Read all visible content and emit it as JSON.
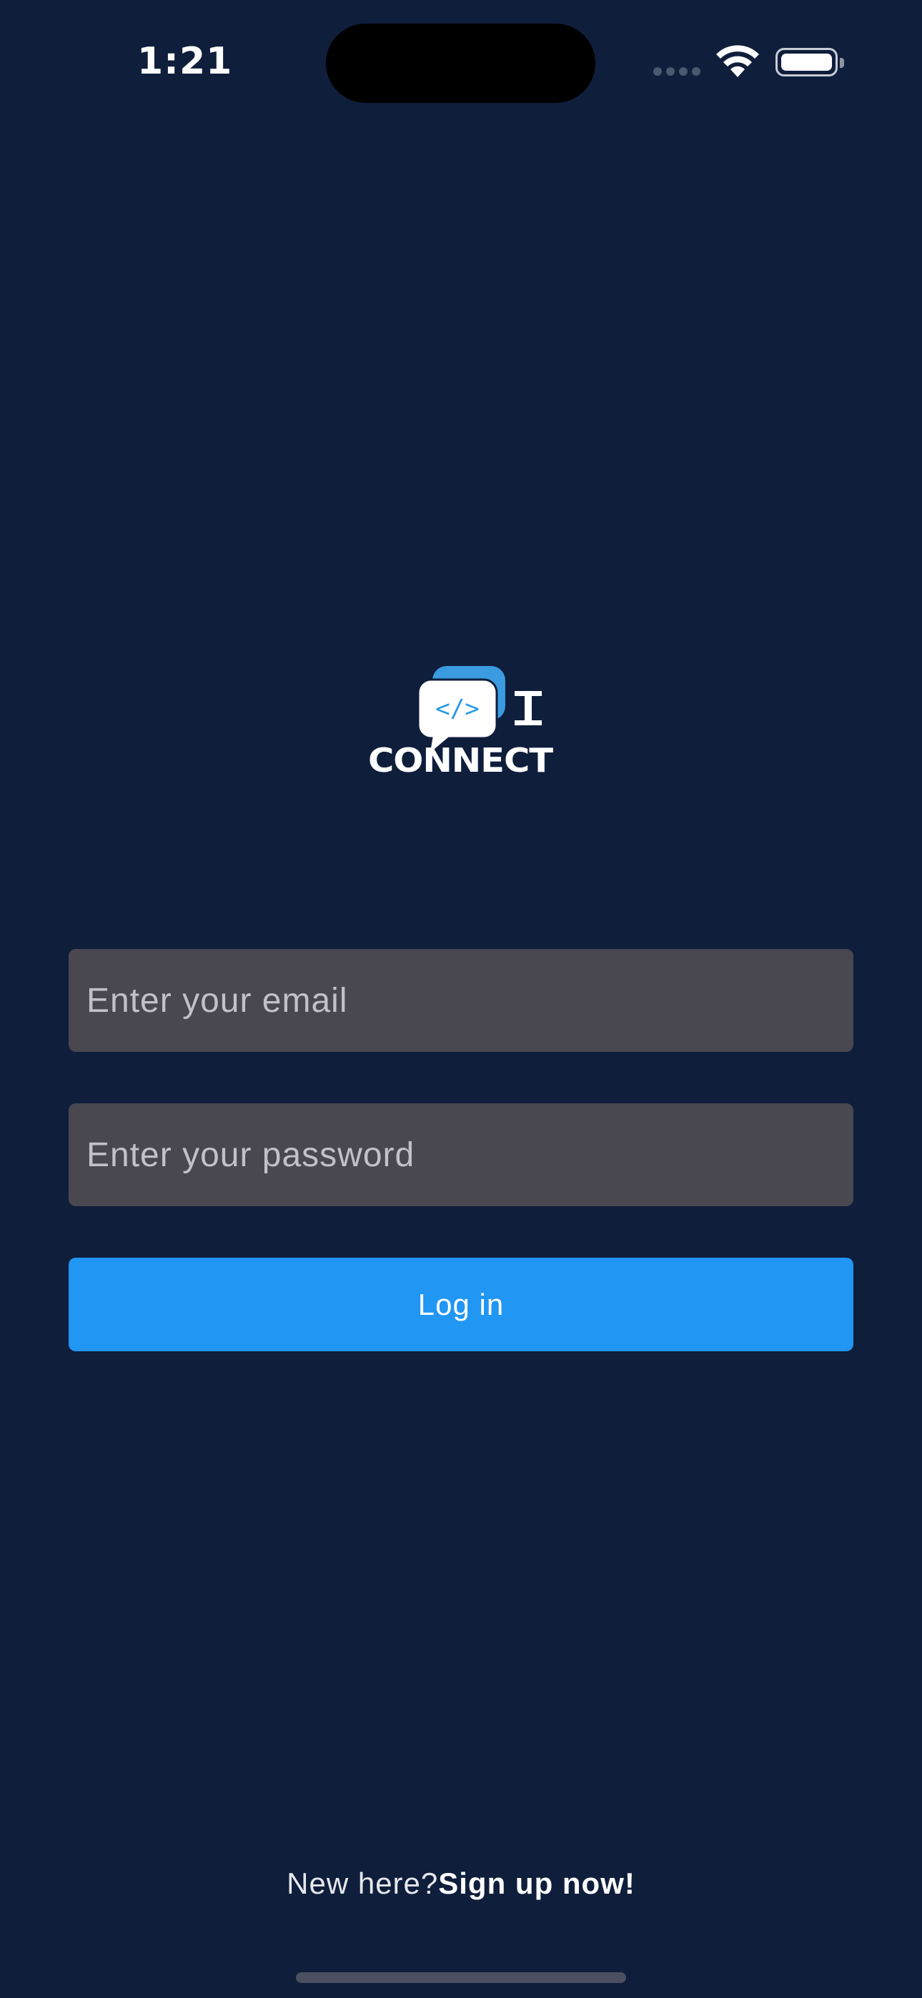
{
  "status_bar": {
    "time": "1:21"
  },
  "logo": {
    "icon_name": "connect-it-logo",
    "code_glyph": "</>",
    "wordmark": "CONNECT",
    "wordmark_suffix": "I"
  },
  "form": {
    "email_placeholder": "Enter your email",
    "email_value": "",
    "password_placeholder": "Enter your password",
    "password_value": "",
    "login_label": "Log in"
  },
  "footer": {
    "prompt": "New here?",
    "signup_link": "Sign up now!"
  },
  "colors": {
    "background": "#0f1e3b",
    "input_background": "#49474f",
    "accent": "#2196f3"
  }
}
